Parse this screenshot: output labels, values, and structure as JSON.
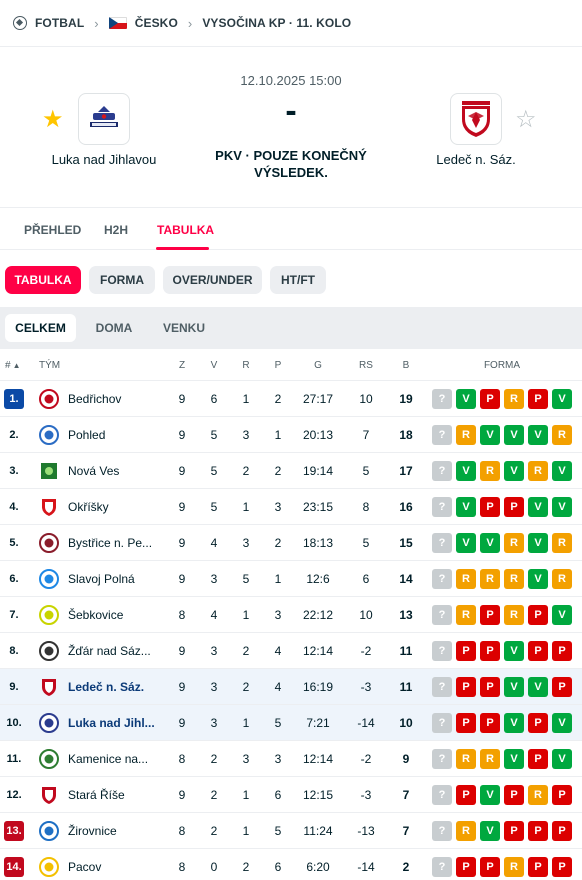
{
  "breadcrumb": {
    "sport": "FOTBAL",
    "country": "ČESKO",
    "competition": "VYSOČINA KP · 11. KOLO"
  },
  "match": {
    "datetime": "12.10.2025 15:00",
    "score": "-",
    "status": "PKV · POUZE KONEČNÝ VÝSLEDEK.",
    "home": {
      "name": "Luka nad Jihlavou",
      "favorite": true
    },
    "away": {
      "name": "Ledeč n. Sáz.",
      "favorite": false
    }
  },
  "tabs": [
    "PŘEHLED",
    "H2H",
    "TABULKA"
  ],
  "active_tab": "TABULKA",
  "pills": [
    "TABULKA",
    "FORMA",
    "OVER/UNDER",
    "HT/FT"
  ],
  "active_pill": "TABULKA",
  "subtabs": [
    "CELKEM",
    "DOMA",
    "VENKU"
  ],
  "active_subtab": "CELKEM",
  "table": {
    "headers": {
      "rank": "#",
      "sort_icon": "▲",
      "team": "TÝM",
      "z": "Z",
      "v": "V",
      "r": "R",
      "p": "P",
      "g": "G",
      "rs": "RS",
      "b": "B",
      "form": "FORMA"
    },
    "rows": [
      {
        "rank": "1.",
        "team": "Bedřichov",
        "z": "9",
        "v": "6",
        "r": "1",
        "p": "2",
        "g": "27:17",
        "rs": "10",
        "b": "19",
        "form": [
          "?",
          "V",
          "P",
          "R",
          "P",
          "V"
        ]
      },
      {
        "rank": "2.",
        "team": "Pohled",
        "z": "9",
        "v": "5",
        "r": "3",
        "p": "1",
        "g": "20:13",
        "rs": "7",
        "b": "18",
        "form": [
          "?",
          "R",
          "V",
          "V",
          "V",
          "R"
        ]
      },
      {
        "rank": "3.",
        "team": "Nová Ves",
        "z": "9",
        "v": "5",
        "r": "2",
        "p": "2",
        "g": "19:14",
        "rs": "5",
        "b": "17",
        "form": [
          "?",
          "V",
          "R",
          "V",
          "R",
          "V"
        ]
      },
      {
        "rank": "4.",
        "team": "Okříšky",
        "z": "9",
        "v": "5",
        "r": "1",
        "p": "3",
        "g": "23:15",
        "rs": "8",
        "b": "16",
        "form": [
          "?",
          "V",
          "P",
          "P",
          "V",
          "V"
        ]
      },
      {
        "rank": "5.",
        "team": "Bystřice n. Pe...",
        "z": "9",
        "v": "4",
        "r": "3",
        "p": "2",
        "g": "18:13",
        "rs": "5",
        "b": "15",
        "form": [
          "?",
          "V",
          "V",
          "R",
          "V",
          "R"
        ]
      },
      {
        "rank": "6.",
        "team": "Slavoj Polná",
        "z": "9",
        "v": "3",
        "r": "5",
        "p": "1",
        "g": "12:6",
        "rs": "6",
        "b": "14",
        "form": [
          "?",
          "R",
          "R",
          "R",
          "V",
          "R"
        ]
      },
      {
        "rank": "7.",
        "team": "Šebkovice",
        "z": "8",
        "v": "4",
        "r": "1",
        "p": "3",
        "g": "22:12",
        "rs": "10",
        "b": "13",
        "form": [
          "?",
          "R",
          "P",
          "R",
          "P",
          "V"
        ]
      },
      {
        "rank": "8.",
        "team": "Žďár nad Sáz...",
        "z": "9",
        "v": "3",
        "r": "2",
        "p": "4",
        "g": "12:14",
        "rs": "-2",
        "b": "11",
        "form": [
          "?",
          "P",
          "P",
          "V",
          "P",
          "P"
        ]
      },
      {
        "rank": "9.",
        "team": "Ledeč n. Sáz.",
        "z": "9",
        "v": "3",
        "r": "2",
        "p": "4",
        "g": "16:19",
        "rs": "-3",
        "b": "11",
        "form": [
          "?",
          "P",
          "P",
          "V",
          "V",
          "P"
        ],
        "highlight": true
      },
      {
        "rank": "10.",
        "team": "Luka nad Jihl...",
        "z": "9",
        "v": "3",
        "r": "1",
        "p": "5",
        "g": "7:21",
        "rs": "-14",
        "b": "10",
        "form": [
          "?",
          "P",
          "P",
          "V",
          "P",
          "V"
        ],
        "highlight": true
      },
      {
        "rank": "11.",
        "team": "Kamenice na...",
        "z": "8",
        "v": "2",
        "r": "3",
        "p": "3",
        "g": "12:14",
        "rs": "-2",
        "b": "9",
        "form": [
          "?",
          "R",
          "R",
          "V",
          "P",
          "V"
        ]
      },
      {
        "rank": "12.",
        "team": "Stará Říše",
        "z": "9",
        "v": "2",
        "r": "1",
        "p": "6",
        "g": "12:15",
        "rs": "-3",
        "b": "7",
        "form": [
          "?",
          "P",
          "V",
          "P",
          "R",
          "P"
        ]
      },
      {
        "rank": "13.",
        "team": "Žirovnice",
        "z": "8",
        "v": "2",
        "r": "1",
        "p": "5",
        "g": "11:24",
        "rs": "-13",
        "b": "7",
        "form": [
          "?",
          "R",
          "V",
          "P",
          "P",
          "P"
        ]
      },
      {
        "rank": "14.",
        "team": "Pacov",
        "z": "8",
        "v": "0",
        "r": "2",
        "p": "6",
        "g": "6:20",
        "rs": "-14",
        "b": "2",
        "form": [
          "?",
          "P",
          "P",
          "R",
          "P",
          "P"
        ]
      }
    ]
  },
  "colors": {
    "accent": "#ff0046",
    "win": "#00a83f",
    "loss": "#dc0000",
    "draw": "#f3a000",
    "unknown": "#c8cdd0",
    "promotion": "#0b4aa6",
    "relegation": "#c1091e"
  }
}
